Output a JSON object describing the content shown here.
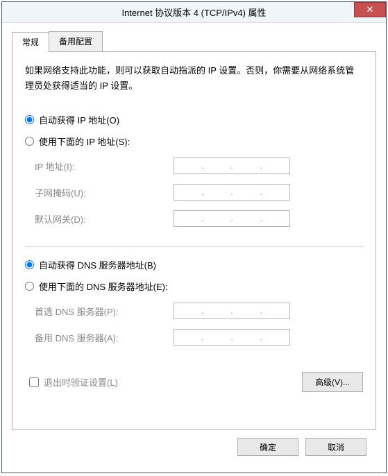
{
  "window": {
    "title": "Internet 协议版本 4 (TCP/IPv4) 属性",
    "close_icon": "✕"
  },
  "tabs": {
    "general": "常规",
    "alternate": "备用配置"
  },
  "description": "如果网络支持此功能，则可以获取自动指派的 IP 设置。否则，你需要从网络系统管理员处获得适当的 IP 设置。",
  "ip": {
    "auto": "自动获得 IP 地址(O)",
    "manual": "使用下面的 IP 地址(S):",
    "address_label": "IP 地址(I):",
    "subnet_label": "子网掩码(U):",
    "gateway_label": "默认网关(D):"
  },
  "dns": {
    "auto": "自动获得 DNS 服务器地址(B)",
    "manual": "使用下面的 DNS 服务器地址(E):",
    "preferred_label": "首选 DNS 服务器(P):",
    "alternate_label": "备用 DNS 服务器(A):"
  },
  "validate_label": "退出时验证设置(L)",
  "advanced_label": "高级(V)...",
  "footer": {
    "ok": "确定",
    "cancel": "取消"
  }
}
